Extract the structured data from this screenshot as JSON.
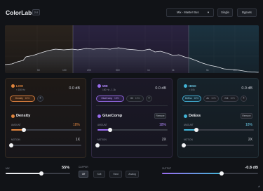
{
  "header": {
    "title": "ColorLab",
    "version": "2.0",
    "preset": "Mix - Master Bus",
    "single_label": "Single",
    "bypass_label": "Bypass"
  },
  "spectrum": {
    "freq_labels": [
      "50",
      "100",
      "200",
      "500",
      "1k",
      "2k",
      "5k",
      "10k"
    ]
  },
  "bands": {
    "low": {
      "name": "LOW",
      "range": "< 150 Hz",
      "gain": "0.0 dB",
      "color": "#e0853e",
      "chip": "Density",
      "chip_value": "18%",
      "effect": "Density",
      "amount_label": "AMOUNT",
      "amount_value": "18%",
      "amount_level": 0.18,
      "motion_label": "MOTION",
      "motion_value": "1X",
      "motion_level": 0.0
    },
    "mid": {
      "name": "MID",
      "range": "150 Hz - 1.3k",
      "gain": "0.0 dB",
      "color": "#9a6cf0",
      "chip": "GlueComp",
      "chip_value": "18%",
      "chip2": "Glt",
      "chip2_value": "10%",
      "effect": "GlueComp",
      "remove_label": "Remove",
      "amount_label": "AMOUNT",
      "amount_value": "18%",
      "amount_level": 0.18,
      "motion_label": "MOTION",
      "motion_value": "2X",
      "motion_level": 0.0
    },
    "high": {
      "name": "HIGH",
      "range": "> 5.0k",
      "gain": "0.0 dB",
      "color": "#42b4d6",
      "chip": "DeEss",
      "chip_value": "18%",
      "chip2": "Air",
      "chip2_value": "10%",
      "chip3": "Grit",
      "chip3_value": "10%",
      "effect": "DeEss",
      "remove_label": "Remove",
      "amount_label": "AMOUNT",
      "amount_value": "18%",
      "amount_level": 0.18,
      "motion_label": "MOTION",
      "motion_value": "2X",
      "motion_level": 0.0
    }
  },
  "footer": {
    "mix_label": "MIX",
    "mix_value": "55%",
    "mix_level": 0.55,
    "clipper_label": "CLIPPER",
    "clipper_options": [
      "Off",
      "Soft",
      "Hard",
      "Analog"
    ],
    "clipper_selected": "Off",
    "output_label": "OUTPUT",
    "output_value": "-0.8 dB",
    "output_level": 0.62
  },
  "colors": {
    "accent_low": "#e0853e",
    "accent_mid": "#9a6cf0",
    "accent_high": "#42b4d6"
  }
}
